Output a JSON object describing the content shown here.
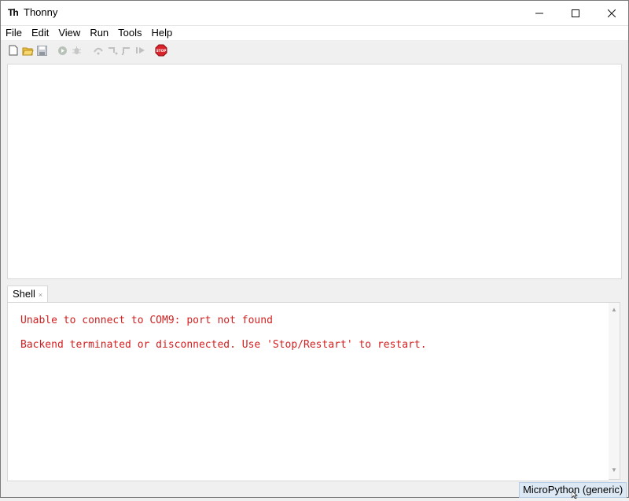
{
  "window": {
    "title": "Thonny",
    "icon_text": "Th",
    "controls": {
      "minimize": "─",
      "maximize": "☐",
      "close": "✕"
    }
  },
  "menu": [
    "File",
    "Edit",
    "View",
    "Run",
    "Tools",
    "Help"
  ],
  "toolbar": {
    "icons": [
      "new-file-icon",
      "open-file-icon",
      "save-file-icon",
      "run-icon",
      "debug-icon",
      "step-over-icon",
      "step-into-icon",
      "step-out-icon",
      "resume-icon",
      "stop-icon"
    ],
    "stop_label": "STOP"
  },
  "shell": {
    "tab_label": "Shell",
    "tab_close": "×",
    "lines": [
      "Unable to connect to COM9: port not found",
      "Backend terminated or disconnected. Use 'Stop/Restart' to restart."
    ]
  },
  "status": {
    "interpreter": "MicroPython (generic)"
  },
  "colors": {
    "error_text": "#d21f1f",
    "stop_red": "#d9232a",
    "interpreter_bg": "#dce9f5"
  }
}
